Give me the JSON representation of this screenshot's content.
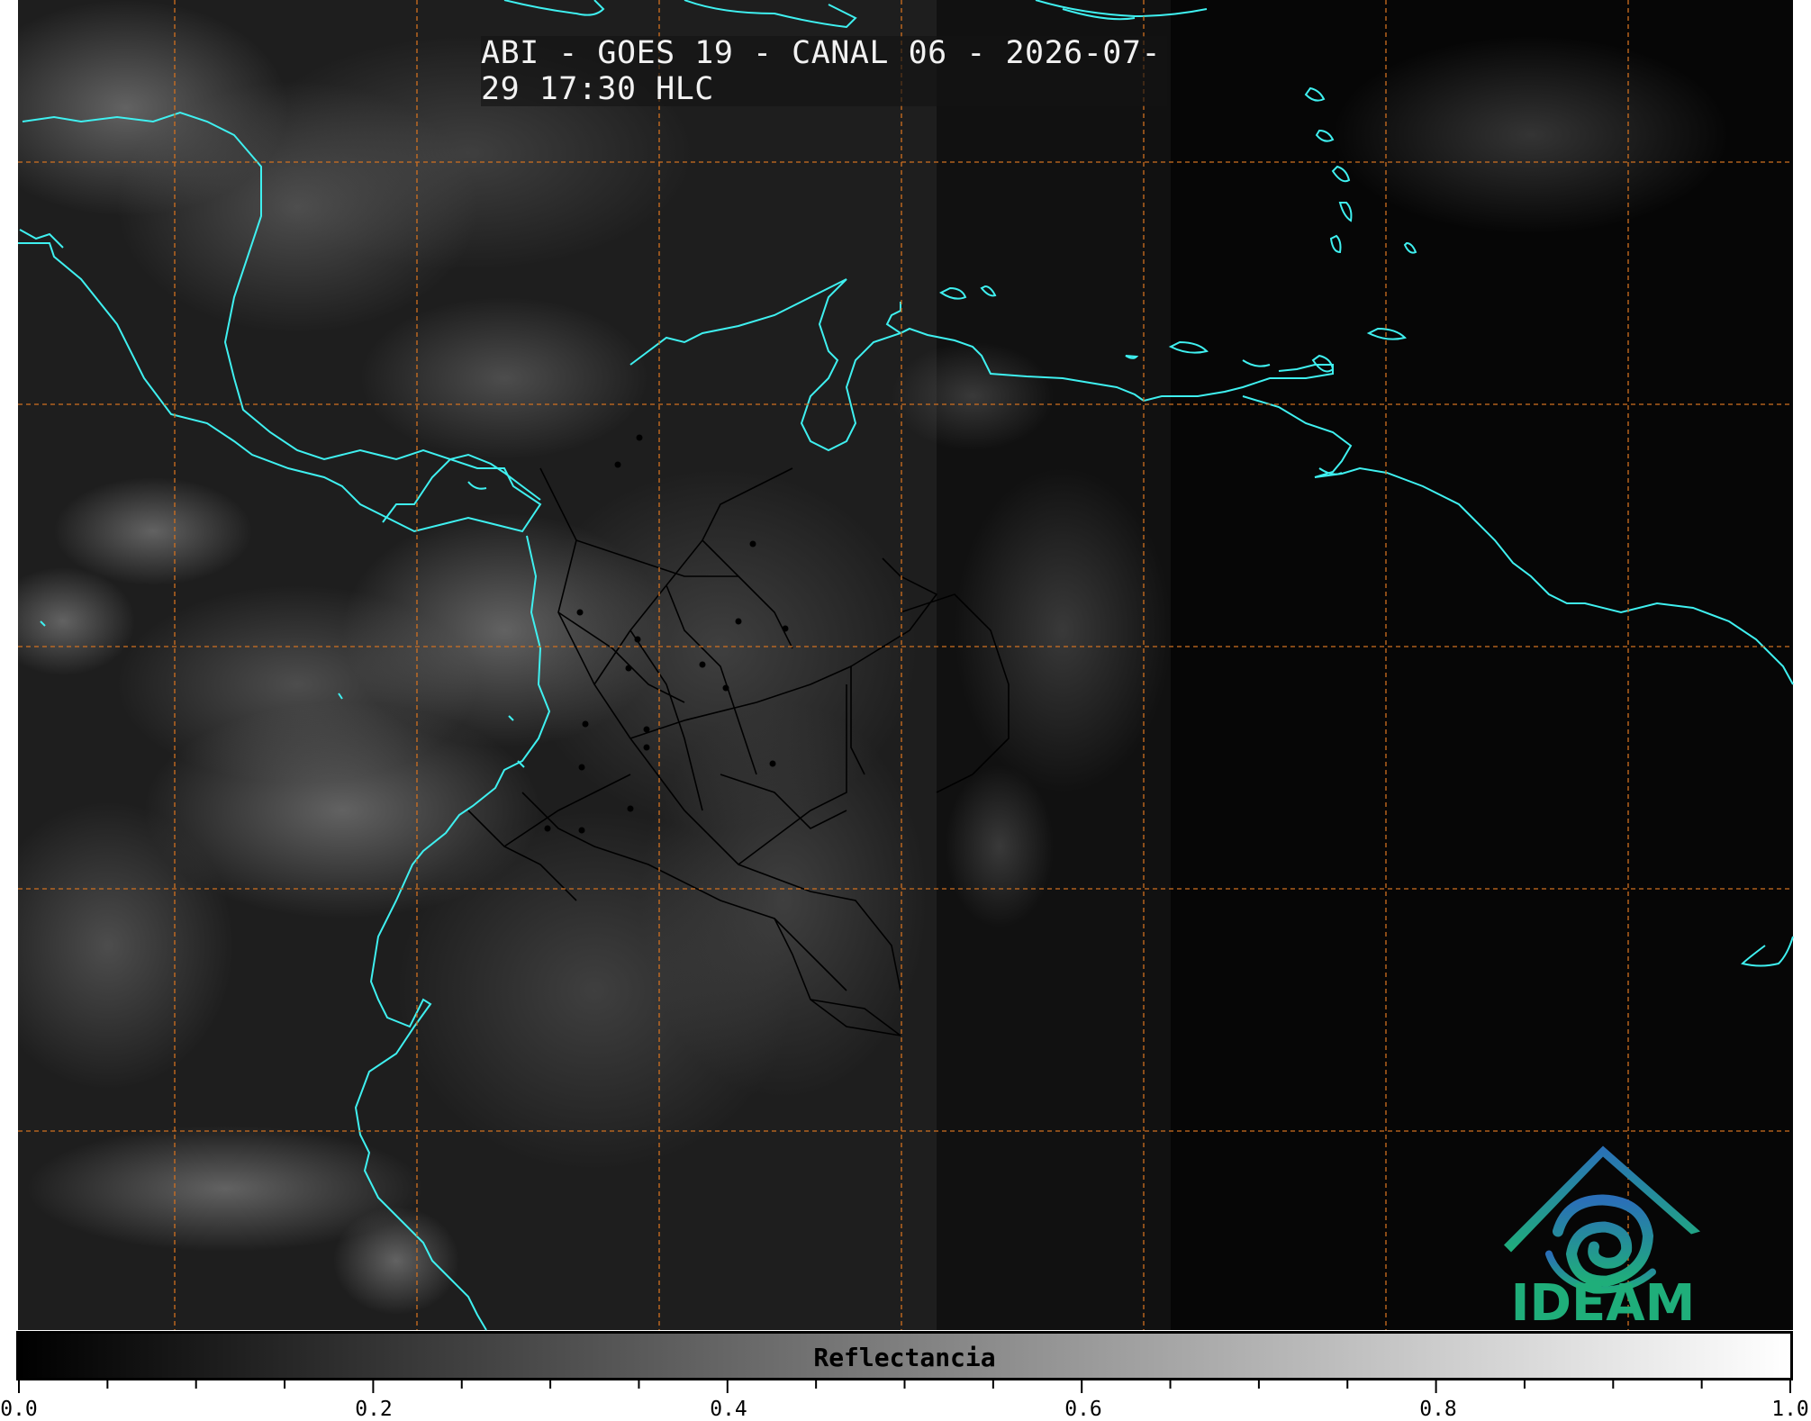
{
  "title": "ABI - GOES 19 - CANAL 06 - 2026-07-29 17:30 HLC",
  "colorbar": {
    "label": "Reflectancia",
    "min": 0.0,
    "max": 1.0,
    "tick_labels": [
      "0.0",
      "0.2",
      "0.4",
      "0.6",
      "0.8",
      "1.0"
    ],
    "minor_tick_step": 0.05
  },
  "logo": {
    "text": "IDEAM"
  },
  "colors": {
    "coastline": "#3ff0f0",
    "gridlines": "#d07020",
    "borders": "#000000",
    "logo_green": "#1fae7a",
    "logo_blue": "#2a7fb8"
  }
}
